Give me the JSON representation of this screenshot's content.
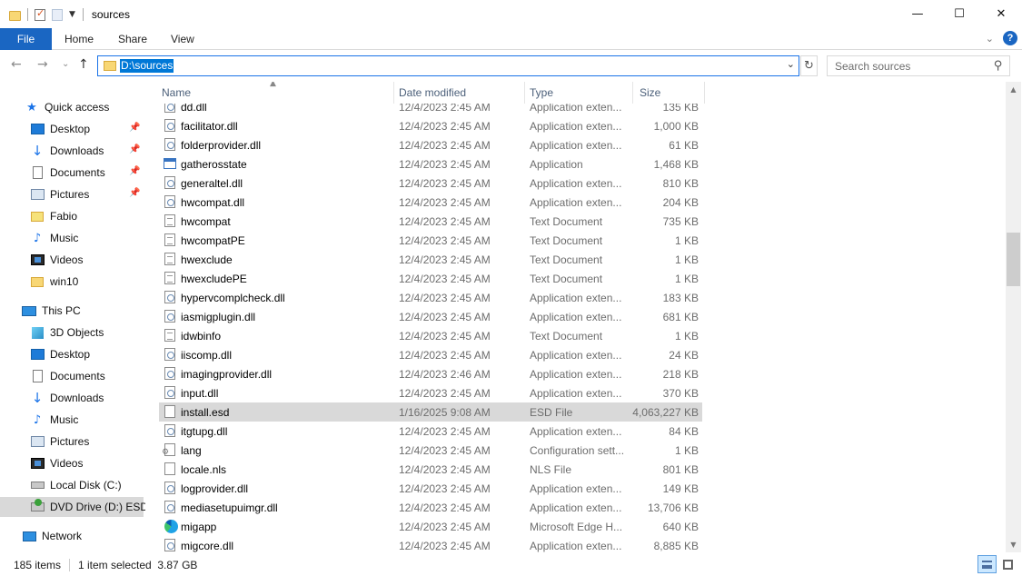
{
  "window": {
    "title": "sources",
    "minimize": "—",
    "maximize": "☐",
    "close": "✕"
  },
  "ribbon": {
    "tabs": [
      "File",
      "Home",
      "Share",
      "View"
    ]
  },
  "address": {
    "path": "D:\\sources",
    "search_placeholder": "Search sources"
  },
  "nav": {
    "quick_access": "Quick access",
    "quick_items": [
      {
        "label": "Desktop",
        "pinned": true
      },
      {
        "label": "Downloads",
        "pinned": true
      },
      {
        "label": "Documents",
        "pinned": true
      },
      {
        "label": "Pictures",
        "pinned": true
      },
      {
        "label": "Fabio",
        "pinned": false
      },
      {
        "label": "Music",
        "pinned": false
      },
      {
        "label": "Videos",
        "pinned": false
      },
      {
        "label": "win10",
        "pinned": false
      }
    ],
    "this_pc": "This PC",
    "pc_items": [
      "3D Objects",
      "Desktop",
      "Documents",
      "Downloads",
      "Music",
      "Pictures",
      "Videos",
      "Local Disk (C:)",
      "DVD Drive (D:) ESD-"
    ],
    "network": "Network"
  },
  "columns": {
    "name": "Name",
    "date": "Date modified",
    "type": "Type",
    "size": "Size"
  },
  "files": [
    {
      "name": "dd.dll",
      "date": "12/4/2023 2:45 AM",
      "type": "Application exten...",
      "size": "135 KB",
      "icon": "dll"
    },
    {
      "name": "facilitator.dll",
      "date": "12/4/2023 2:45 AM",
      "type": "Application exten...",
      "size": "1,000 KB",
      "icon": "dll"
    },
    {
      "name": "folderprovider.dll",
      "date": "12/4/2023 2:45 AM",
      "type": "Application exten...",
      "size": "61 KB",
      "icon": "dll"
    },
    {
      "name": "gatherosstate",
      "date": "12/4/2023 2:45 AM",
      "type": "Application",
      "size": "1,468 KB",
      "icon": "app"
    },
    {
      "name": "generaltel.dll",
      "date": "12/4/2023 2:45 AM",
      "type": "Application exten...",
      "size": "810 KB",
      "icon": "dll"
    },
    {
      "name": "hwcompat.dll",
      "date": "12/4/2023 2:45 AM",
      "type": "Application exten...",
      "size": "204 KB",
      "icon": "dll"
    },
    {
      "name": "hwcompat",
      "date": "12/4/2023 2:45 AM",
      "type": "Text Document",
      "size": "735 KB",
      "icon": "txt"
    },
    {
      "name": "hwcompatPE",
      "date": "12/4/2023 2:45 AM",
      "type": "Text Document",
      "size": "1 KB",
      "icon": "txt"
    },
    {
      "name": "hwexclude",
      "date": "12/4/2023 2:45 AM",
      "type": "Text Document",
      "size": "1 KB",
      "icon": "txt"
    },
    {
      "name": "hwexcludePE",
      "date": "12/4/2023 2:45 AM",
      "type": "Text Document",
      "size": "1 KB",
      "icon": "txt"
    },
    {
      "name": "hypervcomplcheck.dll",
      "date": "12/4/2023 2:45 AM",
      "type": "Application exten...",
      "size": "183 KB",
      "icon": "dll"
    },
    {
      "name": "iasmigplugin.dll",
      "date": "12/4/2023 2:45 AM",
      "type": "Application exten...",
      "size": "681 KB",
      "icon": "dll"
    },
    {
      "name": "idwbinfo",
      "date": "12/4/2023 2:45 AM",
      "type": "Text Document",
      "size": "1 KB",
      "icon": "txt"
    },
    {
      "name": "iiscomp.dll",
      "date": "12/4/2023 2:45 AM",
      "type": "Application exten...",
      "size": "24 KB",
      "icon": "dll"
    },
    {
      "name": "imagingprovider.dll",
      "date": "12/4/2023 2:46 AM",
      "type": "Application exten...",
      "size": "218 KB",
      "icon": "dll"
    },
    {
      "name": "input.dll",
      "date": "12/4/2023 2:45 AM",
      "type": "Application exten...",
      "size": "370 KB",
      "icon": "dll"
    },
    {
      "name": "install.esd",
      "date": "1/16/2025 9:08 AM",
      "type": "ESD File",
      "size": "4,063,227 KB",
      "icon": "file",
      "selected": true
    },
    {
      "name": "itgtupg.dll",
      "date": "12/4/2023 2:45 AM",
      "type": "Application exten...",
      "size": "84 KB",
      "icon": "dll"
    },
    {
      "name": "lang",
      "date": "12/4/2023 2:45 AM",
      "type": "Configuration sett...",
      "size": "1 KB",
      "icon": "cfg"
    },
    {
      "name": "locale.nls",
      "date": "12/4/2023 2:45 AM",
      "type": "NLS File",
      "size": "801 KB",
      "icon": "file"
    },
    {
      "name": "logprovider.dll",
      "date": "12/4/2023 2:45 AM",
      "type": "Application exten...",
      "size": "149 KB",
      "icon": "dll"
    },
    {
      "name": "mediasetupuimgr.dll",
      "date": "12/4/2023 2:45 AM",
      "type": "Application exten...",
      "size": "13,706 KB",
      "icon": "dll"
    },
    {
      "name": "migapp",
      "date": "12/4/2023 2:45 AM",
      "type": "Microsoft Edge H...",
      "size": "640 KB",
      "icon": "edge"
    },
    {
      "name": "migcore.dll",
      "date": "12/4/2023 2:45 AM",
      "type": "Application exten...",
      "size": "8,885 KB",
      "icon": "dll"
    }
  ],
  "status": {
    "item_count": "185 items",
    "selection": "1 item selected  3.87 GB"
  }
}
